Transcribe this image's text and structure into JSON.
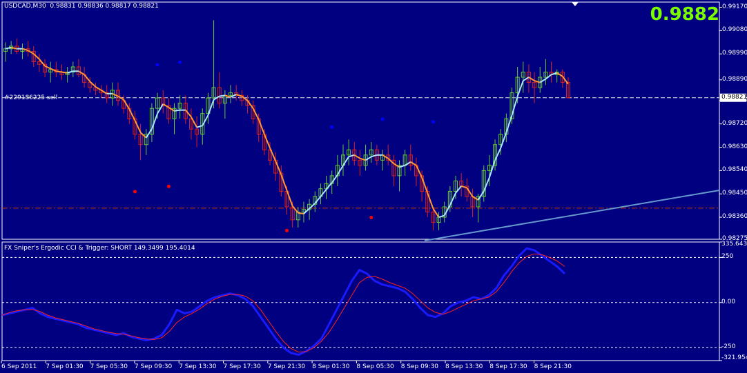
{
  "colors": {
    "background": "#000080",
    "bull_candle": "#66cc33",
    "bear_candle": "#dd1f1f",
    "axis": "#ffffff",
    "level_line": "#e8e8e8",
    "support_line": "#cc3300",
    "trend_line": "#6699cc",
    "cci_line": "#1a1aff",
    "trigger_line": "#ff2020",
    "big_price": "#7cfc00"
  },
  "header": {
    "symbol_info": "USDCAD,M30  0.98831 0.98836 0.98817 0.98821",
    "big_price": "0.9882"
  },
  "order_label": "#229186225 sell",
  "price_axis": {
    "ticks": [
      "0.99170",
      "0.99080",
      "0.98990",
      "0.98890",
      "0.98810",
      "0.98720",
      "0.98630",
      "0.98540",
      "0.98450",
      "0.98360",
      "0.98275"
    ],
    "current_price_label": "0.98821"
  },
  "indicator": {
    "title": "FX Sniper's Ergodic CCI & Trigger: SHORT 149.3499 195.4014",
    "ticks": [
      "335.643",
      "250",
      "0.00",
      "-250",
      "-321.954"
    ]
  },
  "time_axis": {
    "labels": [
      "6 Sep 2011",
      "7 Sep 01:30",
      "7 Sep 05:30",
      "7 Sep 09:30",
      "7 Sep 13:30",
      "7 Sep 17:30",
      "7 Sep 21:30",
      "8 Sep 01:30",
      "8 Sep 05:30",
      "8 Sep 09:30",
      "8 Sep 13:30",
      "8 Sep 17:30",
      "8 Sep 21:30"
    ]
  },
  "chart_data": {
    "type": "candlestick",
    "symbol": "USDCAD",
    "timeframe": "M30",
    "price_range": [
      0.98275,
      0.9919
    ],
    "order_level": 0.98821,
    "support_level": 0.98395,
    "ohlc": [
      [
        0.99,
        0.99035,
        0.9896,
        0.9901
      ],
      [
        0.9901,
        0.9904,
        0.9899,
        0.9902
      ],
      [
        0.9902,
        0.9905,
        0.9899,
        0.99
      ],
      [
        0.99,
        0.9903,
        0.9897,
        0.9901
      ],
      [
        0.9901,
        0.9904,
        0.9898,
        0.99
      ],
      [
        0.99,
        0.9902,
        0.9894,
        0.9896
      ],
      [
        0.9896,
        0.9899,
        0.9892,
        0.9895
      ],
      [
        0.9895,
        0.9897,
        0.989,
        0.9892
      ],
      [
        0.9892,
        0.9896,
        0.9888,
        0.9893
      ],
      [
        0.9893,
        0.9896,
        0.989,
        0.9892
      ],
      [
        0.9892,
        0.9895,
        0.9889,
        0.9891
      ],
      [
        0.9891,
        0.9894,
        0.9888,
        0.9892
      ],
      [
        0.9892,
        0.9896,
        0.989,
        0.9894
      ],
      [
        0.9894,
        0.9897,
        0.989,
        0.9891
      ],
      [
        0.9891,
        0.9894,
        0.9886,
        0.9888
      ],
      [
        0.9888,
        0.989,
        0.9884,
        0.9886
      ],
      [
        0.9886,
        0.9888,
        0.9883,
        0.9885
      ],
      [
        0.9885,
        0.9887,
        0.9882,
        0.9884
      ],
      [
        0.9884,
        0.9887,
        0.988,
        0.9882
      ],
      [
        0.9882,
        0.9888,
        0.9879,
        0.9885
      ],
      [
        0.9885,
        0.9888,
        0.9879,
        0.9881
      ],
      [
        0.9881,
        0.9883,
        0.9876,
        0.9878
      ],
      [
        0.9878,
        0.988,
        0.9872,
        0.9874
      ],
      [
        0.9874,
        0.9877,
        0.9866,
        0.9868
      ],
      [
        0.9868,
        0.9872,
        0.9858,
        0.9864
      ],
      [
        0.9864,
        0.987,
        0.986,
        0.9868
      ],
      [
        0.9868,
        0.988,
        0.9865,
        0.9878
      ],
      [
        0.9878,
        0.9884,
        0.9874,
        0.9882
      ],
      [
        0.9882,
        0.9885,
        0.9876,
        0.9879
      ],
      [
        0.9879,
        0.9882,
        0.9872,
        0.9874
      ],
      [
        0.9874,
        0.988,
        0.9868,
        0.9878
      ],
      [
        0.9878,
        0.9883,
        0.9874,
        0.988
      ],
      [
        0.988,
        0.9883,
        0.9872,
        0.9874
      ],
      [
        0.9874,
        0.9878,
        0.9866,
        0.987
      ],
      [
        0.987,
        0.9875,
        0.9863,
        0.9868
      ],
      [
        0.9868,
        0.9878,
        0.9864,
        0.9876
      ],
      [
        0.9876,
        0.9884,
        0.9872,
        0.9882
      ],
      [
        0.9882,
        0.9912,
        0.9878,
        0.9886
      ],
      [
        0.9886,
        0.9892,
        0.9878,
        0.988
      ],
      [
        0.988,
        0.9885,
        0.9874,
        0.9883
      ],
      [
        0.9883,
        0.9887,
        0.988,
        0.9884
      ],
      [
        0.9884,
        0.9887,
        0.9881,
        0.9883
      ],
      [
        0.9883,
        0.9885,
        0.9879,
        0.9881
      ],
      [
        0.9881,
        0.9883,
        0.9876,
        0.9879
      ],
      [
        0.9879,
        0.9881,
        0.9872,
        0.9874
      ],
      [
        0.9874,
        0.9876,
        0.9865,
        0.9868
      ],
      [
        0.9868,
        0.987,
        0.986,
        0.9862
      ],
      [
        0.9862,
        0.9865,
        0.9856,
        0.9858
      ],
      [
        0.9858,
        0.9861,
        0.985,
        0.9853
      ],
      [
        0.9853,
        0.9856,
        0.9844,
        0.9846
      ],
      [
        0.9846,
        0.9848,
        0.9837,
        0.984
      ],
      [
        0.984,
        0.9842,
        0.9832,
        0.9835
      ],
      [
        0.9835,
        0.984,
        0.9832,
        0.9838
      ],
      [
        0.9838,
        0.9842,
        0.9834,
        0.9839
      ],
      [
        0.9839,
        0.9843,
        0.9835,
        0.9841
      ],
      [
        0.9841,
        0.9846,
        0.9838,
        0.9844
      ],
      [
        0.9844,
        0.9849,
        0.9841,
        0.9847
      ],
      [
        0.9847,
        0.9852,
        0.9843,
        0.9849
      ],
      [
        0.9849,
        0.9854,
        0.9845,
        0.9852
      ],
      [
        0.9852,
        0.986,
        0.9848,
        0.9856
      ],
      [
        0.9856,
        0.9864,
        0.9852,
        0.986
      ],
      [
        0.986,
        0.9866,
        0.9856,
        0.9862
      ],
      [
        0.9862,
        0.9865,
        0.9856,
        0.9858
      ],
      [
        0.9858,
        0.9862,
        0.9852,
        0.9856
      ],
      [
        0.9856,
        0.9864,
        0.9854,
        0.986
      ],
      [
        0.986,
        0.9865,
        0.9857,
        0.9862
      ],
      [
        0.9862,
        0.9864,
        0.9856,
        0.9858
      ],
      [
        0.9858,
        0.9862,
        0.9854,
        0.986
      ],
      [
        0.986,
        0.9864,
        0.9856,
        0.9858
      ],
      [
        0.9858,
        0.986,
        0.9848,
        0.9852
      ],
      [
        0.9852,
        0.9858,
        0.9846,
        0.9856
      ],
      [
        0.9856,
        0.9862,
        0.9852,
        0.986
      ],
      [
        0.986,
        0.9864,
        0.9854,
        0.9856
      ],
      [
        0.9856,
        0.9859,
        0.9848,
        0.9852
      ],
      [
        0.9852,
        0.9854,
        0.9842,
        0.9846
      ],
      [
        0.9846,
        0.9848,
        0.9836,
        0.9838
      ],
      [
        0.9838,
        0.984,
        0.9831,
        0.9834
      ],
      [
        0.9834,
        0.9838,
        0.9831,
        0.9836
      ],
      [
        0.9836,
        0.9842,
        0.9834,
        0.984
      ],
      [
        0.984,
        0.9848,
        0.9838,
        0.9846
      ],
      [
        0.9846,
        0.9852,
        0.9843,
        0.985
      ],
      [
        0.985,
        0.9853,
        0.9844,
        0.9848
      ],
      [
        0.9848,
        0.9851,
        0.9842,
        0.9844
      ],
      [
        0.9844,
        0.9847,
        0.9836,
        0.984
      ],
      [
        0.984,
        0.9845,
        0.9834,
        0.9844
      ],
      [
        0.9844,
        0.9856,
        0.9842,
        0.9854
      ],
      [
        0.9854,
        0.986,
        0.9848,
        0.9856
      ],
      [
        0.9856,
        0.9866,
        0.9854,
        0.9864
      ],
      [
        0.9864,
        0.987,
        0.986,
        0.9868
      ],
      [
        0.9868,
        0.9876,
        0.9865,
        0.9874
      ],
      [
        0.9874,
        0.9886,
        0.9872,
        0.9884
      ],
      [
        0.9884,
        0.9894,
        0.988,
        0.989
      ],
      [
        0.989,
        0.9896,
        0.9884,
        0.9892
      ],
      [
        0.9892,
        0.9895,
        0.9884,
        0.9888
      ],
      [
        0.9888,
        0.9892,
        0.988,
        0.9886
      ],
      [
        0.9886,
        0.9894,
        0.9884,
        0.989
      ],
      [
        0.989,
        0.9897,
        0.9887,
        0.9892
      ],
      [
        0.9892,
        0.9896,
        0.9888,
        0.9891
      ],
      [
        0.9891,
        0.9893,
        0.9888,
        0.9892
      ],
      [
        0.9892,
        0.9893,
        0.9886,
        0.9888
      ],
      [
        0.9888,
        0.989,
        0.9882,
        0.98821
      ]
    ],
    "fractals_up": [
      [
        27,
        0.989
      ],
      [
        31,
        0.9891
      ],
      [
        58,
        0.9866
      ],
      [
        67,
        0.9869
      ],
      [
        76,
        0.9868
      ]
    ],
    "fractals_down": [
      [
        23,
        0.9848
      ],
      [
        29,
        0.985
      ],
      [
        50,
        0.9833
      ],
      [
        65,
        0.9838
      ]
    ],
    "cci_range": [
      -321.954,
      335.643
    ],
    "cci": [
      -70,
      -60,
      -50,
      -40,
      -30,
      -60,
      -80,
      -90,
      -100,
      -110,
      -120,
      -140,
      -150,
      -160,
      -170,
      -180,
      -170,
      -190,
      -200,
      -210,
      -200,
      -180,
      -120,
      -40,
      -60,
      -50,
      -20,
      10,
      30,
      40,
      50,
      40,
      20,
      -20,
      -80,
      -140,
      -200,
      -250,
      -280,
      -290,
      -270,
      -240,
      -200,
      -120,
      -40,
      40,
      120,
      180,
      160,
      120,
      100,
      90,
      80,
      60,
      20,
      -30,
      -70,
      -80,
      -60,
      -20,
      0,
      10,
      30,
      20,
      40,
      80,
      150,
      200,
      260,
      300,
      290,
      260,
      230,
      200,
      160
    ],
    "trigger": [
      -70,
      -55,
      -45,
      -40,
      -38,
      -50,
      -70,
      -85,
      -95,
      -105,
      -115,
      -130,
      -145,
      -155,
      -165,
      -172,
      -175,
      -185,
      -195,
      -202,
      -205,
      -195,
      -160,
      -110,
      -80,
      -60,
      -35,
      -5,
      20,
      35,
      45,
      45,
      35,
      10,
      -40,
      -100,
      -160,
      -215,
      -255,
      -275,
      -272,
      -250,
      -215,
      -165,
      -100,
      -30,
      40,
      110,
      140,
      145,
      130,
      110,
      95,
      80,
      50,
      10,
      -30,
      -55,
      -65,
      -50,
      -30,
      -10,
      10,
      20,
      30,
      60,
      110,
      170,
      220,
      255,
      270,
      265,
      250,
      230,
      200
    ]
  }
}
